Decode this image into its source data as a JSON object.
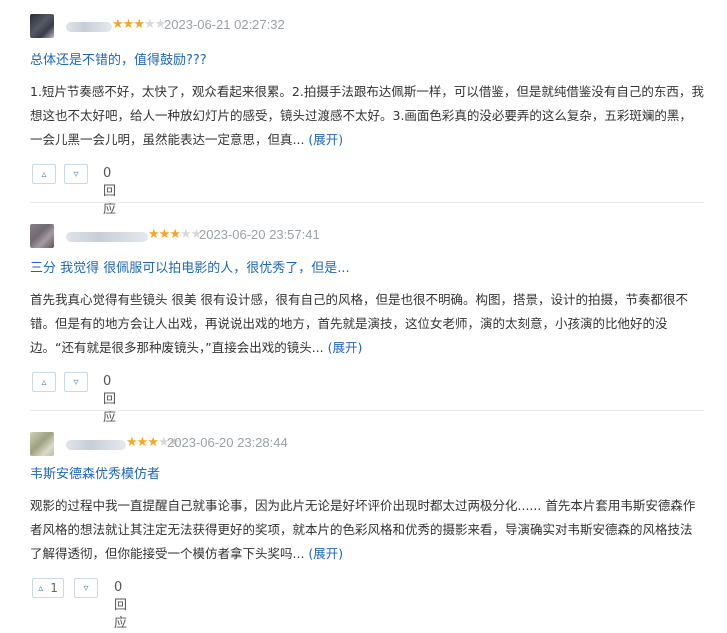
{
  "reviews": [
    {
      "date": "2023-06-21 02:27:32",
      "stars": [
        "★",
        "★",
        "★",
        "★",
        "★"
      ],
      "rating": 3,
      "title": "总体还是不错的，值得鼓励???",
      "body": "1.短片节奏感不好，太快了，观众看起来很累。2.拍摄手法跟布达佩斯一样，可以借鉴，但是就纯借鉴没有自己的东西，我想这也不太好吧，给人一种放幻灯片的感受，镜头过渡感不太好。3.画面色彩真的没必要弄的这么复杂，五彩斑斓的黑，一会儿黑一会儿明，虽然能表达一定意思，但真...",
      "expand": "(展开)",
      "up_icon": "▵",
      "down_icon": "▿",
      "up_count": "",
      "reply": "0回应"
    },
    {
      "date": "2023-06-20 23:57:41",
      "stars": [
        "★",
        "★",
        "★",
        "★",
        "★"
      ],
      "rating": 3,
      "title": "三分 我觉得 很佩服可以拍电影的人，很优秀了，但是...",
      "body": "首先我真心觉得有些镜头 很美 很有设计感，很有自己的风格，但是也很不明确。构图，搭景，设计的拍摄，节奏都很不错。但是有的地方会让人出戏，再说说出戏的地方，首先就是演技，这位女老师，演的太刻意，小孩演的比他好的没边。“还有就是很多那种废镜头，”直接会出戏的镜头...",
      "expand": "(展开)",
      "up_icon": "▵",
      "down_icon": "▿",
      "up_count": "",
      "reply": "0回应"
    },
    {
      "date": "2023-06-20 23:28:44",
      "stars": [
        "★",
        "★",
        "★",
        "★",
        "★"
      ],
      "rating": 3,
      "title": "韦斯安德森优秀模仿者",
      "body": "观影的过程中我一直提醒自己就事论事，因为此片无论是好坏评价出现时都太过两极分化...... 首先本片套用韦斯安德森作者风格的想法就让其注定无法获得更好的奖项，就本片的色彩风格和优秀的摄影来看，导演确实对韦斯安德森的风格技法了解得透彻，但你能接受一个模仿者拿下头奖吗...",
      "expand": "(展开)",
      "up_icon": "▵",
      "down_icon": "▿",
      "up_count": "1",
      "reply": "0回应"
    }
  ],
  "colors": {
    "link": "#1f66b8",
    "star_on": "#f5a623",
    "star_off": "#d9d9d9",
    "date": "#9aa0a6"
  }
}
